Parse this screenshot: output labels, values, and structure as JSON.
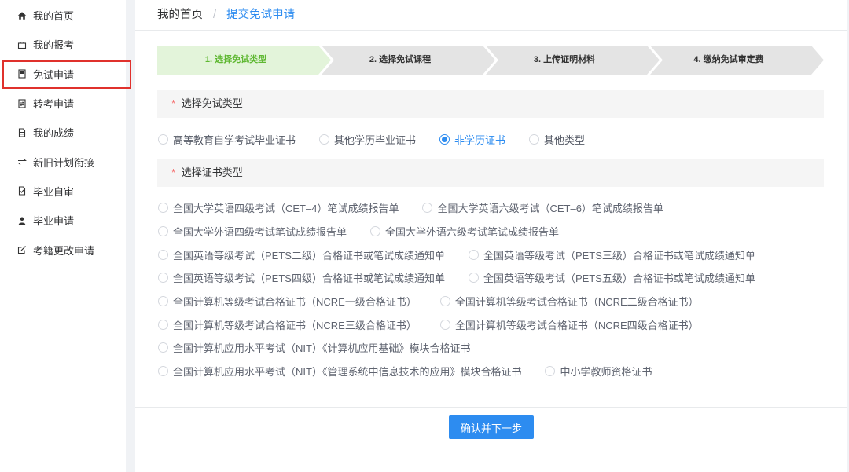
{
  "colors": {
    "primary": "#2d8cf0",
    "step_current_bg": "#e3f4da",
    "step_current_text": "#5fb832",
    "step_pending_bg": "#e4e4e4",
    "required": "#f56c6c",
    "highlight_border": "#e0312c",
    "section_bg": "#f5f5f5",
    "page_bg": "#f0f2f5"
  },
  "sidebar": {
    "items": [
      {
        "label": "我的首页",
        "icon": "home-icon"
      },
      {
        "label": "我的报考",
        "icon": "briefcase-icon"
      },
      {
        "label": "免试申请",
        "icon": "document-icon"
      },
      {
        "label": "转考申请",
        "icon": "transfer-doc-icon"
      },
      {
        "label": "我的成绩",
        "icon": "file-text-icon"
      },
      {
        "label": "新旧计划衔接",
        "icon": "swap-icon"
      },
      {
        "label": "毕业自审",
        "icon": "check-doc-icon"
      },
      {
        "label": "毕业申请",
        "icon": "user-icon"
      },
      {
        "label": "考籍更改申请",
        "icon": "edit-icon"
      }
    ],
    "highlighted_index": 2
  },
  "breadcrumb": {
    "home": "我的首页",
    "separator": "/",
    "current": "提交免试申请"
  },
  "steps": [
    {
      "label": "1. 选择免试类型",
      "state": "current"
    },
    {
      "label": "2. 选择免试课程",
      "state": "pending"
    },
    {
      "label": "3. 上传证明材料",
      "state": "pending"
    },
    {
      "label": "4. 缴纳免试审定费",
      "state": "pending"
    }
  ],
  "exemption_type": {
    "required_mark": "*",
    "title": "选择免试类型",
    "options": [
      "高等教育自学考试毕业证书",
      "其他学历毕业证书",
      "非学历证书",
      "其他类型"
    ],
    "selected": "非学历证书"
  },
  "certificate_type": {
    "required_mark": "*",
    "title": "选择证书类型",
    "rows": [
      [
        "全国大学英语四级考试（CET–4）笔试成绩报告单",
        "全国大学英语六级考试（CET–6）笔试成绩报告单"
      ],
      [
        "全国大学外语四级考试笔试成绩报告单",
        "全国大学外语六级考试笔试成绩报告单"
      ],
      [
        "全国英语等级考试（PETS二级）合格证书或笔试成绩通知单",
        "全国英语等级考试（PETS三级）合格证书或笔试成绩通知单"
      ],
      [
        "全国英语等级考试（PETS四级）合格证书或笔试成绩通知单",
        "全国英语等级考试（PETS五级）合格证书或笔试成绩通知单"
      ],
      [
        "全国计算机等级考试合格证书（NCRE一级合格证书）",
        "全国计算机等级考试合格证书（NCRE二级合格证书）"
      ],
      [
        "全国计算机等级考试合格证书（NCRE三级合格证书）",
        "全国计算机等级考试合格证书（NCRE四级合格证书）"
      ],
      [
        "全国计算机应用水平考试（NIT）《计算机应用基础》模块合格证书"
      ],
      [
        "全国计算机应用水平考试（NIT）《管理系统中信息技术的应用》模块合格证书",
        "中小学教师资格证书"
      ]
    ]
  },
  "submit_label": "确认并下一步"
}
